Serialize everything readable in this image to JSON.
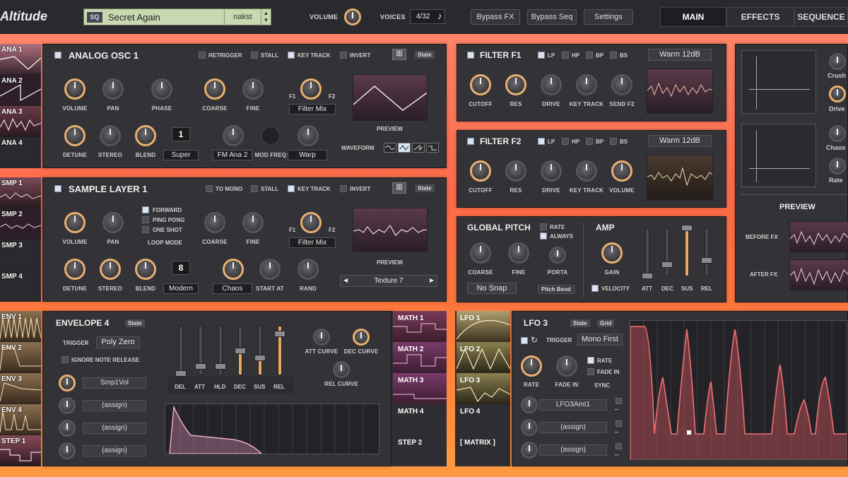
{
  "app": {
    "title": "Altitude"
  },
  "header": {
    "preset_tag": "SQ",
    "preset_name": "Secret Again",
    "preset_author": "nakst",
    "volume_label": "VOLUME",
    "voices_label": "VOICES",
    "voices_value": "4/32",
    "voices_icon": "eighth-note-icon",
    "bypass_fx": "Bypass FX",
    "bypass_seq": "Bypass Seq",
    "settings": "Settings",
    "tabs": [
      "MAIN",
      "EFFECTS",
      "SEQUENCE"
    ]
  },
  "osc_sidebar": [
    "ANA 1",
    "ANA 2",
    "ANA 3",
    "ANA 4"
  ],
  "smp_sidebar": [
    "SMP 1",
    "SMP 2",
    "SMP 3",
    "SMP 4"
  ],
  "env_sidebar": [
    "ENV 1",
    "ENV 2",
    "ENV 3",
    "ENV 4",
    "STEP 1"
  ],
  "osc": {
    "title": "ANALOG OSC 1",
    "retrigger": "RETRIGGER",
    "stall": "STALL",
    "key_track": "KEY TRACK",
    "invert": "INVERT",
    "state": "State",
    "volume": "VOLUME",
    "pan": "PAN",
    "phase": "PHASE",
    "coarse": "COARSE",
    "fine": "FINE",
    "f1": "F1",
    "f2": "F2",
    "filter_mix": "Filter Mix",
    "preview": "PREVIEW",
    "detune": "DETUNE",
    "stereo": "STEREO",
    "blend": "BLEND",
    "unison_count": "1",
    "unison_mode": "Super",
    "fm_source": "FM Ana 2",
    "mod_freq": "MOD FREQ",
    "warp": "Warp",
    "waveform": "WAVEFORM"
  },
  "sample": {
    "title": "SAMPLE LAYER 1",
    "to_mono": "TO MONO",
    "stall": "STALL",
    "key_track": "KEY TRACK",
    "invert": "INVERT",
    "state": "State",
    "volume": "VOLUME",
    "pan": "PAN",
    "forward": "FORWARD",
    "ping_pong": "PING PONG",
    "one_shot": "ONE SHOT",
    "loop_mode": "LOOP MODE",
    "coarse": "COARSE",
    "fine": "FINE",
    "f1": "F1",
    "f2": "F2",
    "filter_mix": "Filter Mix",
    "preview": "PREVIEW",
    "detune": "DETUNE",
    "stereo": "STEREO",
    "blend": "BLEND",
    "unison_count": "8",
    "unison_mode": "Modern",
    "chaos": "Chaos",
    "start_at": "START AT",
    "rand": "RAND",
    "sample_name": "Texture 7"
  },
  "filter1": {
    "title": "FILTER F1",
    "lp": "LP",
    "hp": "HP",
    "bp": "BP",
    "bs": "BS",
    "type": "Warm 12dB",
    "cutoff": "CUTOFF",
    "res": "RES",
    "drive": "DRIVE",
    "key_track": "KEY TRACK",
    "send": "SEND F2"
  },
  "filter2": {
    "title": "FILTER F2",
    "lp": "LP",
    "hp": "HP",
    "bp": "BP",
    "bs": "BS",
    "type": "Warm 12dB",
    "cutoff": "CUTOFF",
    "res": "RES",
    "drive": "DRIVE",
    "key_track": "KEY TRACK",
    "volume": "VOLUME"
  },
  "pitch": {
    "title": "GLOBAL PITCH",
    "rate": "RATE",
    "always": "ALWAYS",
    "coarse": "COARSE",
    "fine": "FINE",
    "porta": "PORTA",
    "snap": "No Snap",
    "pitch_bend": "Pitch Bend"
  },
  "amp": {
    "title": "AMP",
    "gain": "GAIN",
    "velocity": "VELOCITY",
    "att": "ATT",
    "dec": "DEC",
    "sus": "SUS",
    "rel": "REL"
  },
  "fx_side": {
    "crush": "Crush",
    "drive": "Drive",
    "chaos": "Chaos",
    "rate": "Rate",
    "preview": "PREVIEW",
    "before": "BEFORE FX",
    "after": "AFTER FX"
  },
  "envelope": {
    "title": "ENVELOPE 4",
    "state": "State",
    "trigger": "TRIGGER",
    "trigger_value": "Poly Zero",
    "ignore": "IGNORE NOTE RELEASE",
    "assign1": "Smp1Vol",
    "assign2": "(assign)",
    "assign3": "(assign)",
    "assign4": "(assign)",
    "del": "DEL",
    "att": "ATT",
    "hld": "HLD",
    "dec": "DEC",
    "sus": "SUS",
    "rel": "REL",
    "att_curve": "ATT CURVE",
    "dec_curve": "DEC CURVE",
    "rel_curve": "REL CURVE"
  },
  "math": [
    "MATH 1",
    "MATH 2",
    "MATH 3",
    "MATH 4",
    "STEP 2"
  ],
  "lfo_list": [
    "LFO 1",
    "LFO 2",
    "LFO 3",
    "LFO 4",
    "[ MATRIX ]"
  ],
  "lfo": {
    "title": "LFO 3",
    "state": "State",
    "grid": "Grid",
    "trigger": "TRIGGER",
    "trigger_value": "Mono First",
    "rate": "RATE",
    "fade_in": "FADE IN",
    "sync": "SYNC",
    "rate_chk": "RATE",
    "fade_chk": "FADE IN",
    "assign1": "LFO3Amt1",
    "assign2": "(assign)",
    "assign3": "(assign)"
  },
  "colors": {
    "accent": "#e8b070",
    "pink": "#e88aa0",
    "bg": "#333337"
  }
}
